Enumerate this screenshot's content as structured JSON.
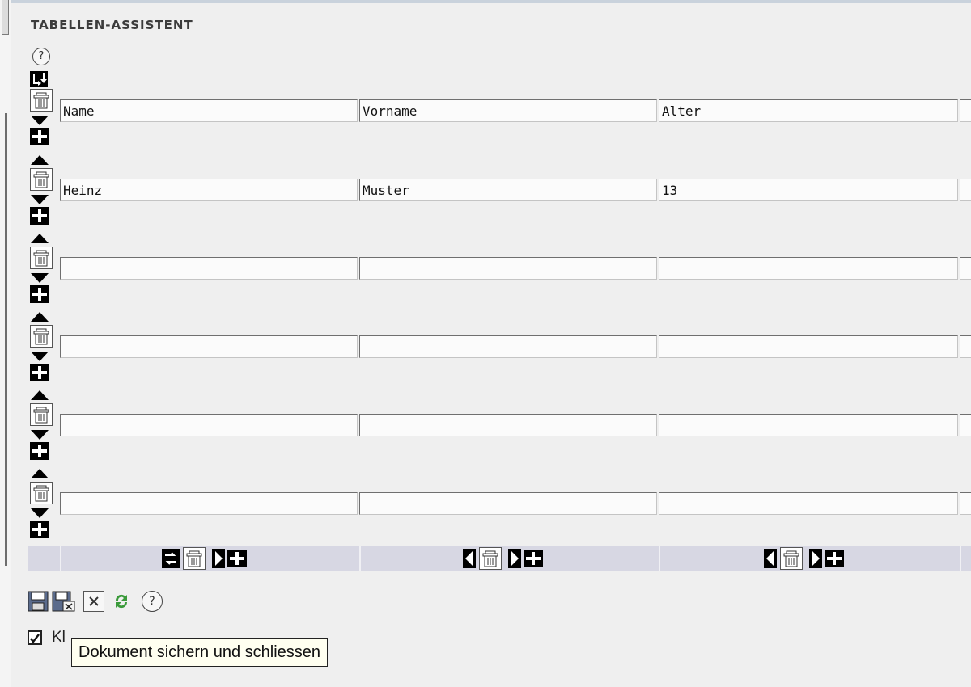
{
  "title": "TABELLEN-ASSISTENT",
  "help_icon": "question-mark-icon",
  "table": {
    "rows": [
      [
        "Name",
        "Vorname",
        "Alter"
      ],
      [
        "Heinz",
        "Muster",
        "13"
      ],
      [
        "",
        "",
        ""
      ],
      [
        "",
        "",
        ""
      ],
      [
        "",
        "",
        ""
      ],
      [
        "",
        "",
        ""
      ]
    ]
  },
  "toolbar": {
    "icons": [
      "save-icon",
      "save-close-icon",
      "close-icon",
      "refresh-icon",
      "help-icon"
    ]
  },
  "checkbox": {
    "label": "Kl",
    "checked": true
  },
  "tooltip": {
    "text": "Dokument sichern und schliessen"
  }
}
